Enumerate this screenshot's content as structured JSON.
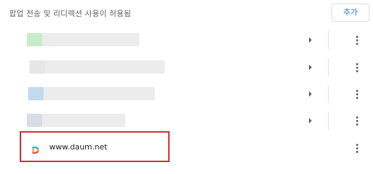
{
  "header": {
    "title": "팝업 전송 및 리디렉션 사용이 허용됨",
    "add_label": "추가"
  },
  "sites": [
    {
      "blurred": true,
      "favicon_color": "#c8ecc9",
      "bar_color": "#ececec"
    },
    {
      "blurred": true,
      "favicon_color": "#e6e6e6",
      "bar_color": "#ececec"
    },
    {
      "blurred": true,
      "favicon_color": "#c3d9ee",
      "bar_color": "#ececec"
    },
    {
      "blurred": true,
      "favicon_color": "#d8dde3",
      "bar_color": "#ececec"
    },
    {
      "blurred": false,
      "url": "www.daum.net",
      "icon": "daum-logo-icon",
      "highlighted": true
    }
  ],
  "icons": {
    "expand": "chevron-right-icon",
    "more": "more-vert-icon"
  },
  "colors": {
    "accent": "#1a73e8",
    "highlight_border": "#d9262c",
    "icon": "#5f6368"
  }
}
